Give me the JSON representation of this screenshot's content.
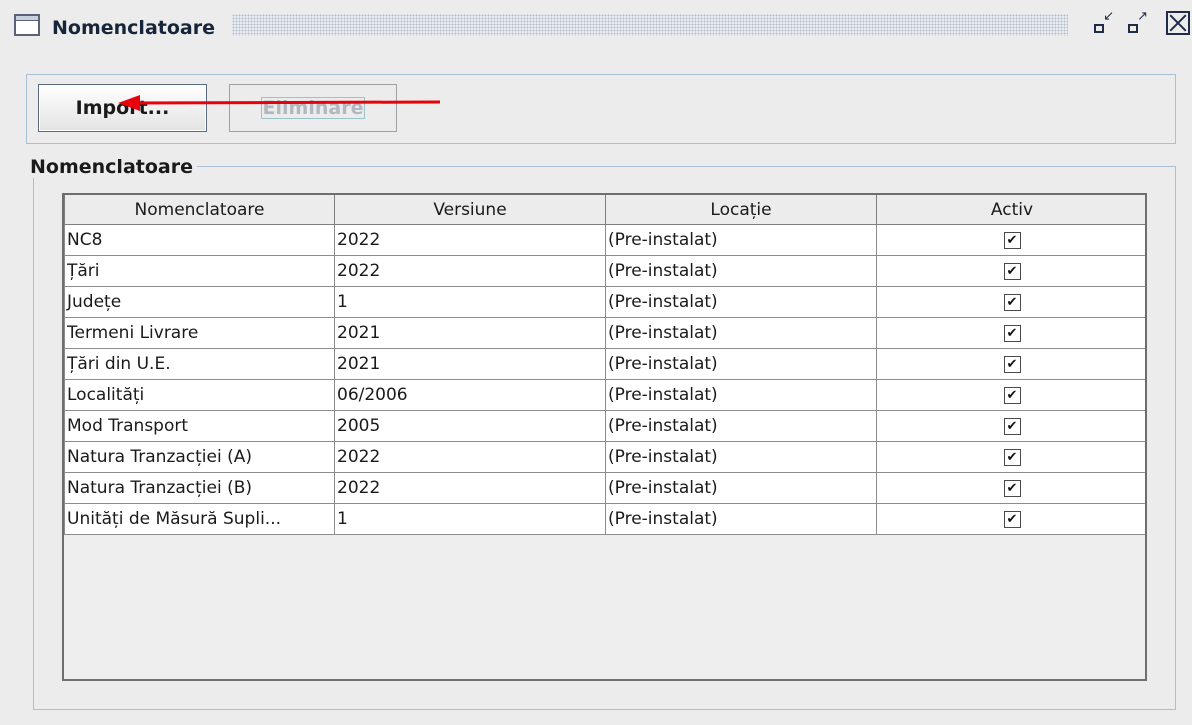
{
  "window": {
    "title": "Nomenclatoare"
  },
  "toolbar": {
    "import_label": "Import...",
    "delete_label": "Eliminare"
  },
  "group": {
    "title": "Nomenclatoare"
  },
  "table": {
    "headers": [
      "Nomenclatoare",
      "Versiune",
      "Locație",
      "Activ"
    ],
    "rows": [
      {
        "name": "NC8",
        "version": "2022",
        "location": "(Pre-instalat)",
        "active": true
      },
      {
        "name": "Țări",
        "version": "2022",
        "location": "(Pre-instalat)",
        "active": true
      },
      {
        "name": "Județe",
        "version": "1",
        "location": "(Pre-instalat)",
        "active": true
      },
      {
        "name": "Termeni Livrare",
        "version": " 2021",
        "location": "(Pre-instalat)",
        "active": true
      },
      {
        "name": "Țări din U.E.",
        "version": "2021",
        "location": "(Pre-instalat)",
        "active": true
      },
      {
        "name": "Localități",
        "version": "06/2006",
        "location": "(Pre-instalat)",
        "active": true
      },
      {
        "name": "Mod Transport",
        "version": "2005",
        "location": "(Pre-instalat)",
        "active": true
      },
      {
        "name": "Natura Tranzacției (A)",
        "version": "2022",
        "location": "(Pre-instalat)",
        "active": true
      },
      {
        "name": "Natura Tranzacției (B)",
        "version": "2022",
        "location": "(Pre-instalat)",
        "active": true
      },
      {
        "name": "Unități de Măsură Supli...",
        "version": "1",
        "location": "(Pre-instalat)",
        "active": true
      }
    ]
  },
  "icons": {
    "window": "window-icon",
    "minimize": "minimize-icon",
    "maximize": "maximize-icon",
    "close": "close-icon",
    "annotation": "red-arrow-icon"
  },
  "colors": {
    "annotation_arrow": "#e8000b",
    "panel_border": "#a8bfd9",
    "title_text": "#16253a"
  }
}
